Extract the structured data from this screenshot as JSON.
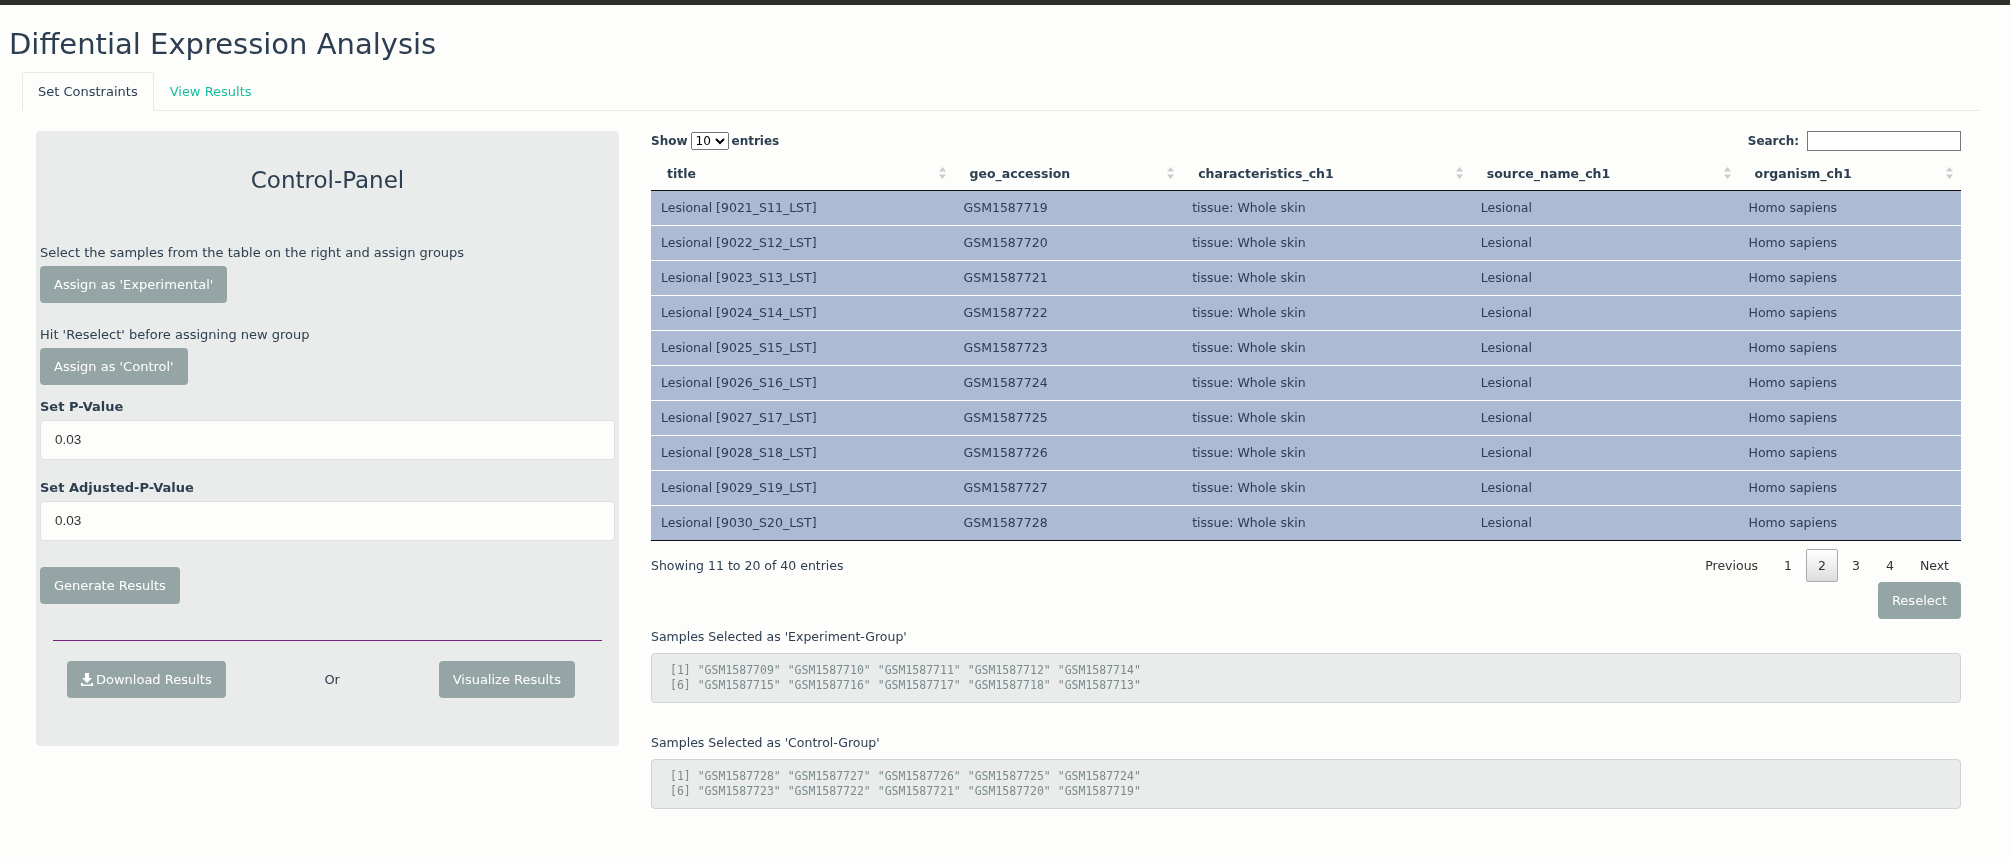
{
  "title": "Diffential Expression Analysis",
  "tabs": [
    {
      "label": "Set Constraints",
      "selected": true
    },
    {
      "label": "View Results",
      "selected": false
    }
  ],
  "panel": {
    "heading": "Control-Panel",
    "instruction_1": "Select the samples from the table on the right and assign groups",
    "assign_experimental": "Assign as 'Experimental'",
    "instruction_2": "Hit 'Reselect' before assigning new group",
    "assign_control": "Assign as 'Control'",
    "fields": [
      {
        "label": "Set P-Value",
        "value": "0.03"
      },
      {
        "label": "Set Adjusted-P-Value",
        "value": "0.03"
      }
    ],
    "generate": "Generate Results",
    "download": "Download Results",
    "or": "Or",
    "visualize": "Visualize Results"
  },
  "table_controls": {
    "show": "Show",
    "page_size": "10",
    "entries": "entries",
    "search_label": "Search:"
  },
  "table": {
    "columns": [
      "title",
      "geo_accession",
      "characteristics_ch1",
      "source_name_ch1",
      "organism_ch1"
    ],
    "rows": [
      {
        "selected": true,
        "cells": [
          "Lesional [9021_S11_LST]",
          "GSM1587719",
          "tissue: Whole skin",
          "Lesional",
          "Homo sapiens"
        ]
      },
      {
        "selected": true,
        "cells": [
          "Lesional [9022_S12_LST]",
          "GSM1587720",
          "tissue: Whole skin",
          "Lesional",
          "Homo sapiens"
        ]
      },
      {
        "selected": true,
        "cells": [
          "Lesional [9023_S13_LST]",
          "GSM1587721",
          "tissue: Whole skin",
          "Lesional",
          "Homo sapiens"
        ]
      },
      {
        "selected": true,
        "cells": [
          "Lesional [9024_S14_LST]",
          "GSM1587722",
          "tissue: Whole skin",
          "Lesional",
          "Homo sapiens"
        ]
      },
      {
        "selected": true,
        "cells": [
          "Lesional [9025_S15_LST]",
          "GSM1587723",
          "tissue: Whole skin",
          "Lesional",
          "Homo sapiens"
        ]
      },
      {
        "selected": true,
        "cells": [
          "Lesional [9026_S16_LST]",
          "GSM1587724",
          "tissue: Whole skin",
          "Lesional",
          "Homo sapiens"
        ]
      },
      {
        "selected": true,
        "cells": [
          "Lesional [9027_S17_LST]",
          "GSM1587725",
          "tissue: Whole skin",
          "Lesional",
          "Homo sapiens"
        ]
      },
      {
        "selected": true,
        "cells": [
          "Lesional [9028_S18_LST]",
          "GSM1587726",
          "tissue: Whole skin",
          "Lesional",
          "Homo sapiens"
        ]
      },
      {
        "selected": true,
        "cells": [
          "Lesional [9029_S19_LST]",
          "GSM1587727",
          "tissue: Whole skin",
          "Lesional",
          "Homo sapiens"
        ]
      },
      {
        "selected": true,
        "cells": [
          "Lesional [9030_S20_LST]",
          "GSM1587728",
          "tissue: Whole skin",
          "Lesional",
          "Homo sapiens"
        ]
      }
    ]
  },
  "info": "Showing 11 to 20 of 40 entries",
  "pagination": [
    {
      "label": "Previous",
      "selected": false
    },
    {
      "label": "1",
      "selected": false
    },
    {
      "label": "2",
      "selected": true
    },
    {
      "label": "3",
      "selected": false
    },
    {
      "label": "4",
      "selected": false
    },
    {
      "label": "Next",
      "selected": false
    }
  ],
  "reselect": "Reselect",
  "outputs": [
    {
      "label": "Samples Selected as 'Experiment-Group'",
      "lines": [
        "[1] \"GSM1587709\" \"GSM1587710\" \"GSM1587711\" \"GSM1587712\" \"GSM1587714\"",
        "[6] \"GSM1587715\" \"GSM1587716\" \"GSM1587717\" \"GSM1587718\" \"GSM1587713\""
      ]
    },
    {
      "label": "Samples Selected as 'Control-Group'",
      "lines": [
        "[1] \"GSM1587728\" \"GSM1587727\" \"GSM1587726\" \"GSM1587725\" \"GSM1587724\"",
        "[6] \"GSM1587723\" \"GSM1587722\" \"GSM1587721\" \"GSM1587720\" \"GSM1587719\""
      ]
    }
  ]
}
